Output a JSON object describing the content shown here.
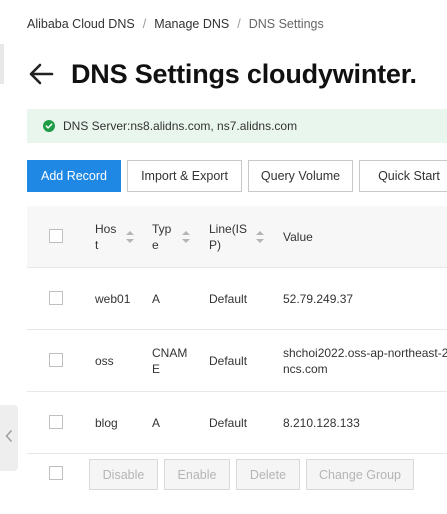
{
  "breadcrumb": {
    "items": [
      "Alibaba Cloud DNS",
      "Manage DNS",
      "DNS Settings"
    ],
    "separator": "/"
  },
  "header": {
    "title": "DNS Settings cloudywinter."
  },
  "status": {
    "text": "DNS Server:ns8.alidns.com, ns7.alidns.com",
    "color": "#1e9b45"
  },
  "toolbar": {
    "add_record": "Add Record",
    "import_export": "Import & Export",
    "query_volume": "Query Volume",
    "quick_start": "Quick Start"
  },
  "table": {
    "columns": {
      "host": "Host",
      "type": "Type",
      "line": "Line(ISP)",
      "value": "Value"
    },
    "column_display": {
      "host": [
        "Hos",
        "t"
      ],
      "type": [
        "Typ",
        "e"
      ],
      "line": [
        "Line(IS",
        "P)"
      ]
    },
    "rows": [
      {
        "host": "web01",
        "type": "A",
        "type_display": [
          "A"
        ],
        "line": "Default",
        "value": "52.79.249.37",
        "value_display": [
          "52.79.249.37"
        ]
      },
      {
        "host": "oss",
        "type": "CNAME",
        "type_display": [
          "CNAM",
          "E"
        ],
        "line": "Default",
        "value": "shchoi2022.oss-ap-northeast-2...ncs.com",
        "value_display": [
          "shchoi2022.oss-ap-northeast-2",
          "ncs.com"
        ]
      },
      {
        "host": "blog",
        "type": "A",
        "type_display": [
          "A"
        ],
        "line": "Default",
        "value": "8.210.128.133",
        "value_display": [
          "8.210.128.133"
        ]
      }
    ]
  },
  "footer": {
    "disable": "Disable",
    "enable": "Enable",
    "delete": "Delete",
    "change_group": "Change Group"
  },
  "colors": {
    "primary": "#1f88e5",
    "success_bg": "#e9f6ee",
    "success": "#1e9b45"
  }
}
